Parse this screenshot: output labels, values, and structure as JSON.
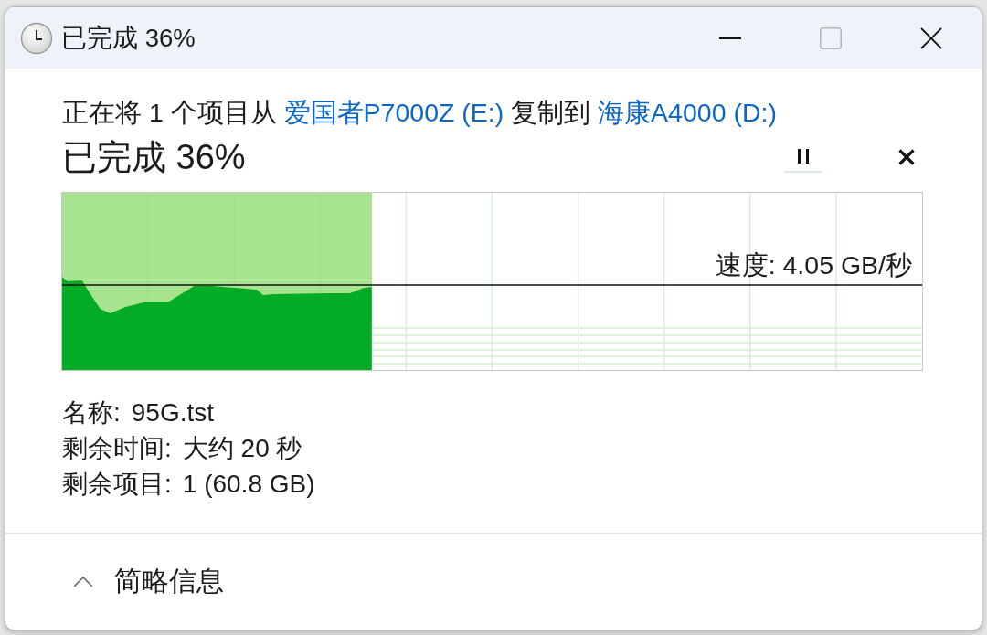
{
  "window": {
    "title": "已完成 36%"
  },
  "message": [
    {
      "kind": "text",
      "text": "正在将 1 个项目从"
    },
    {
      "kind": "link",
      "text": "爱国者P7000Z (E:)"
    },
    {
      "kind": "text",
      "text": "复制到"
    },
    {
      "kind": "link",
      "text": "海康A4000 (D:)"
    }
  ],
  "progress": {
    "heading": "已完成 36%",
    "level": 0.36,
    "speed": "速度: 4.05 GB/秒"
  },
  "details": [
    {
      "label": "名称:",
      "value": "95G.tst"
    },
    {
      "label": "剩余时间:",
      "value": "大约 20 秒"
    },
    {
      "label": "剩余项目:",
      "value": "1 (60.8 GB)"
    }
  ],
  "footer": {
    "label": "简略信息",
    "expanded": true
  }
}
